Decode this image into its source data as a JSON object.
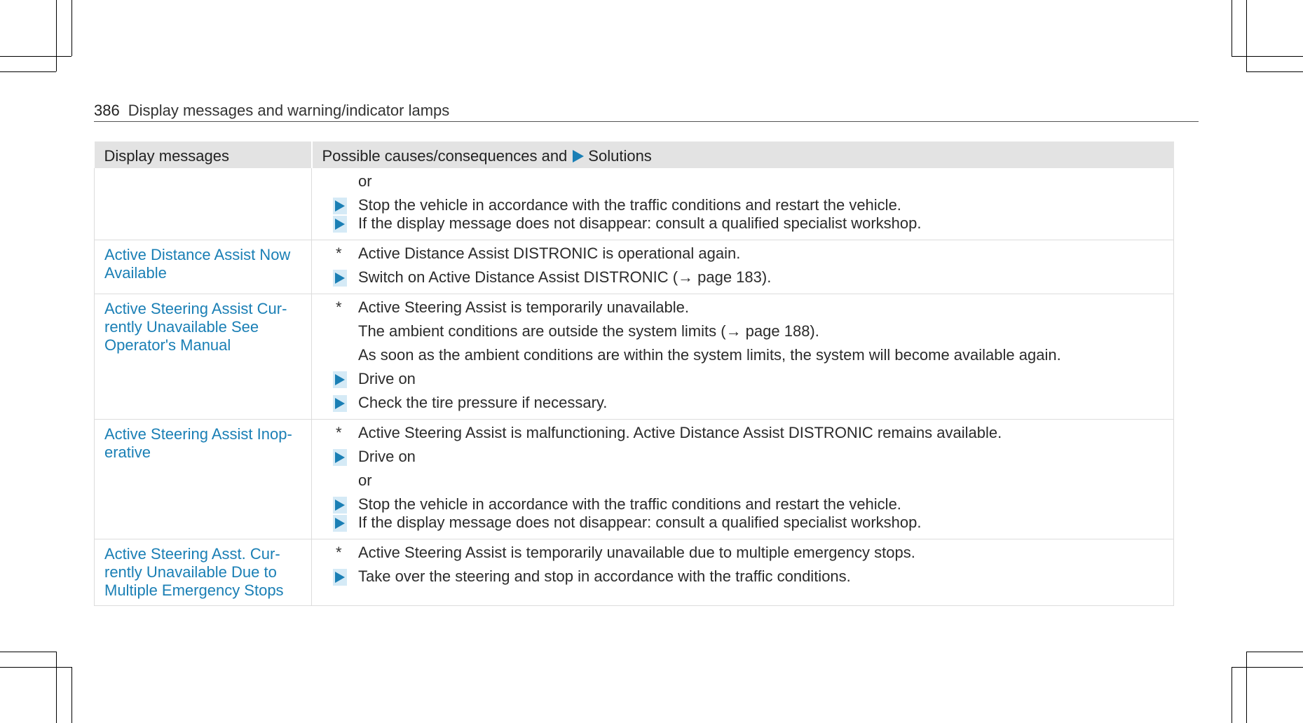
{
  "header": {
    "page_number": "386",
    "section_title": "Display messages and warning/indicator lamps"
  },
  "table": {
    "col_messages": "Display messages",
    "col_causes_prefix": "Possible causes/consequences and",
    "col_causes_suffix": "Solutions",
    "rows": [
      {
        "message": "",
        "lines": [
          {
            "kind": "text",
            "text": "or"
          },
          {
            "kind": "action",
            "text": "Stop the vehicle in accordance with the traffic conditions and restart the vehicle."
          },
          {
            "kind": "action",
            "text": "If the display message does not disappear: consult a qualified specialist workshop."
          }
        ]
      },
      {
        "message": "Active Distance Assist Now Available",
        "lines": [
          {
            "kind": "star",
            "text": "Active Distance Assist DISTRONIC is operational again."
          },
          {
            "kind": "action",
            "text": "Switch on Active Distance Assist DISTRONIC (→ page 183)."
          }
        ]
      },
      {
        "message": "Active Steering Assist Cur-rently Unavailable See Operator's Manual",
        "lines": [
          {
            "kind": "star",
            "text": "Active Steering Assist is temporarily unavailable."
          },
          {
            "kind": "text",
            "text": "The ambient conditions are outside the system limits (→ page 188)."
          },
          {
            "kind": "text",
            "text": "As soon as the ambient conditions are within the system limits, the system will become available again."
          },
          {
            "kind": "action",
            "text": "Drive on"
          },
          {
            "kind": "action",
            "text": "Check the tire pressure if necessary."
          }
        ]
      },
      {
        "message": "Active Steering Assist Inop-erative",
        "lines": [
          {
            "kind": "star",
            "text": "Active Steering Assist is malfunctioning. Active Distance Assist DISTRONIC remains available."
          },
          {
            "kind": "action",
            "text": "Drive on"
          },
          {
            "kind": "text",
            "text": "or"
          },
          {
            "kind": "action",
            "text": "Stop the vehicle in accordance with the traffic conditions and restart the vehicle."
          },
          {
            "kind": "action",
            "text": "If the display message does not disappear: consult a qualified specialist workshop."
          }
        ]
      },
      {
        "message": "Active Steering Asst. Cur-rently Unavailable Due to Multiple Emergency Stops",
        "lines": [
          {
            "kind": "star",
            "text": "Active Steering Assist is temporarily unavailable due to multiple emergency stops."
          },
          {
            "kind": "action",
            "text": "Take over the steering and stop in accordance with the traffic conditions."
          }
        ]
      }
    ]
  },
  "colors": {
    "accent": "#1a7fb5",
    "arrow_bg": "#d5eaf6",
    "header_bg": "#e3e3e3"
  }
}
